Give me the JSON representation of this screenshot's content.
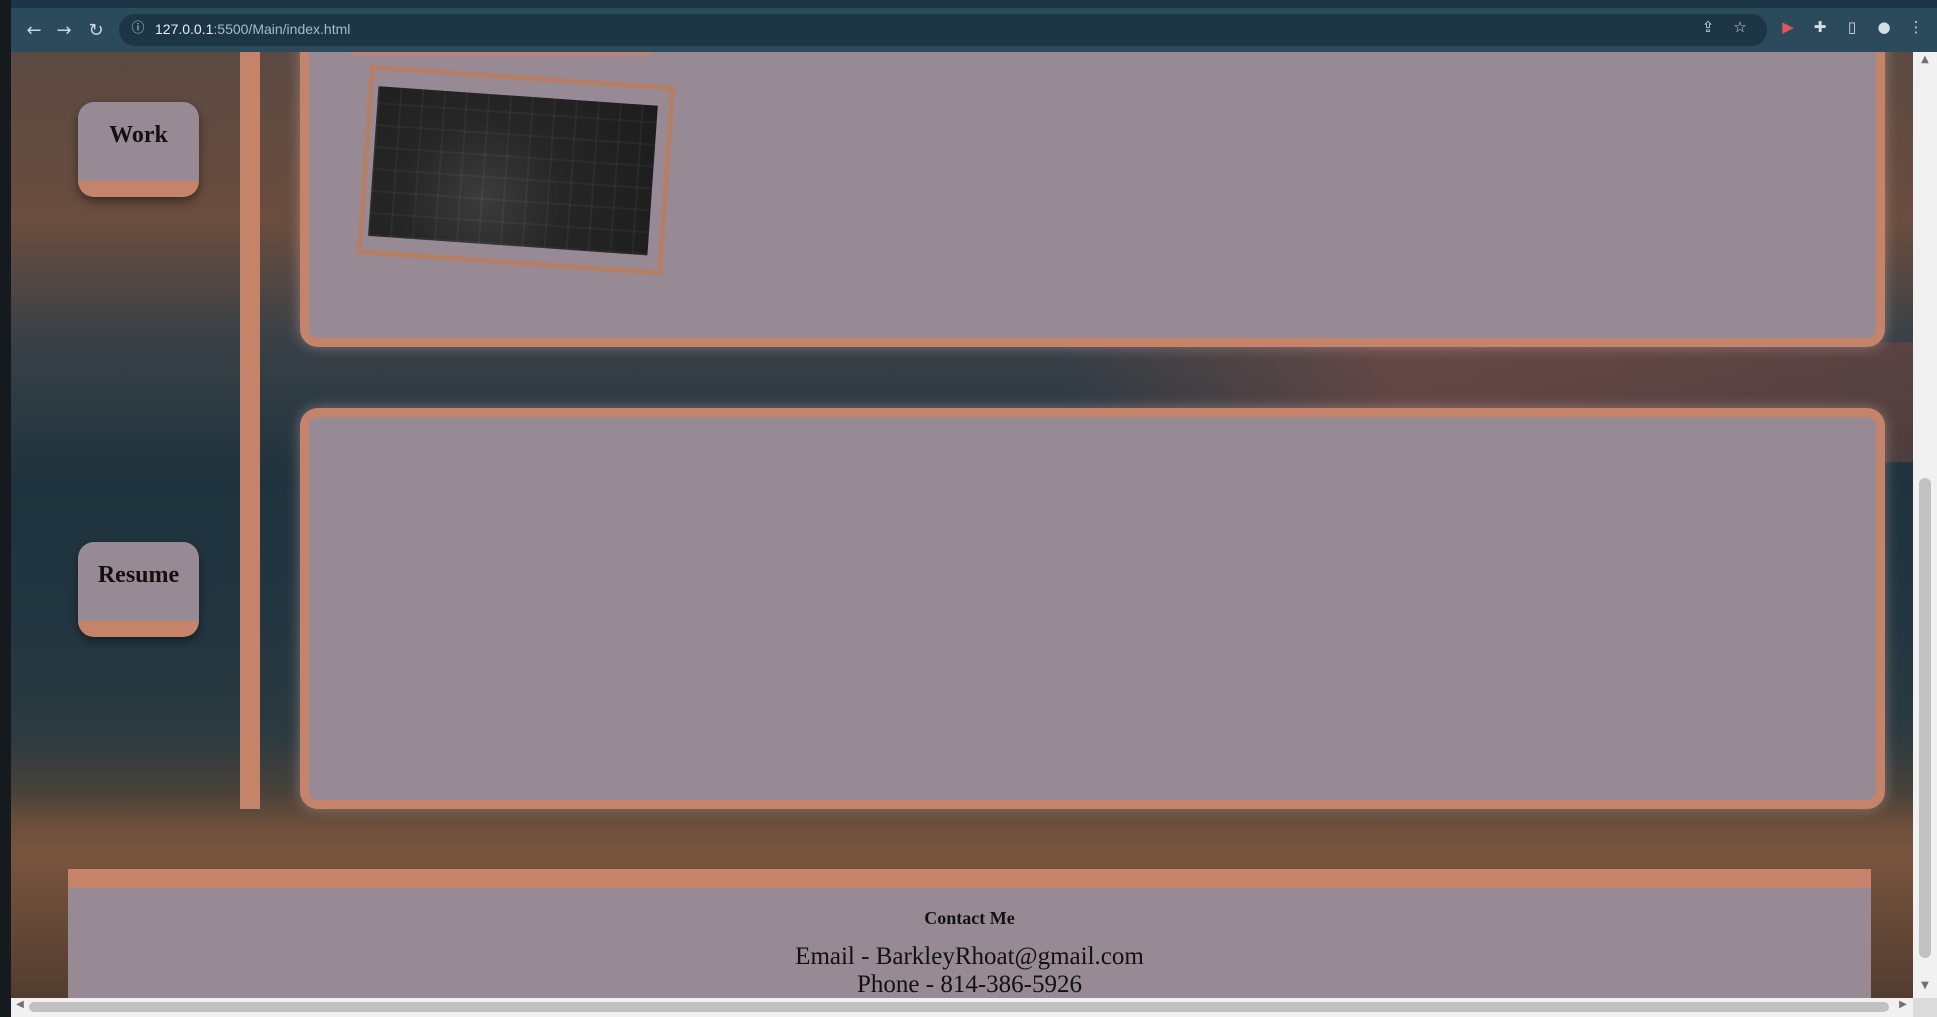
{
  "browser": {
    "url_host": "127.0.0.1",
    "url_rest": ":5500/Main/index.html",
    "icons": {
      "back": "←",
      "forward": "→",
      "reload": "↻",
      "info": "ⓘ",
      "share": "⇪",
      "star": "☆",
      "extension_red": "▶",
      "puzzle": "✚",
      "sidepanel": "▯",
      "profile": "●",
      "menu": "⋮"
    }
  },
  "sidebar": {
    "work_label": "Work",
    "resume_label": "Resume"
  },
  "footer": {
    "heading": "Contact Me",
    "email": "Email - BarkleyRhoat@gmail.com",
    "phone": "Phone - 814-386-5926"
  },
  "colors": {
    "accent": "#c58369",
    "card": "#978a94",
    "chrome": "#2b4a5b"
  }
}
